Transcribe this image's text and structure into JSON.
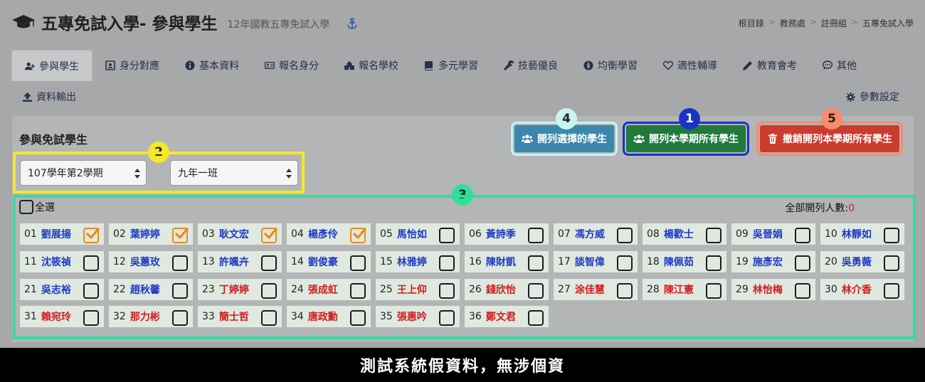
{
  "header": {
    "title": "五專免試入學- 參與學生",
    "subtitle": "12年國教五專免試入學",
    "breadcrumb": [
      "根目錄",
      "教務處",
      "註冊組",
      "五專免試入學"
    ]
  },
  "tabs": [
    {
      "label": "參與學生",
      "icon": "user-plus-icon",
      "active": true
    },
    {
      "label": "身分對應",
      "icon": "id-badge-icon"
    },
    {
      "label": "基本資料",
      "icon": "info-circle-icon"
    },
    {
      "label": "報名身分",
      "icon": "id-card-icon"
    },
    {
      "label": "報名學校",
      "icon": "school-icon"
    },
    {
      "label": "多元學習",
      "icon": "book-icon"
    },
    {
      "label": "技藝優良",
      "icon": "wrench-icon"
    },
    {
      "label": "均衡學習",
      "icon": "accessibility-icon"
    },
    {
      "label": "適性輔導",
      "icon": "heart-icon"
    },
    {
      "label": "教育會考",
      "icon": "pencil-icon"
    },
    {
      "label": "其他",
      "icon": "chat-icon"
    }
  ],
  "toolbar": {
    "export_label": "資料輸出",
    "params_label": "參數設定"
  },
  "panel": {
    "title": "參與免試學生",
    "buttons": {
      "list_selected": "開列選擇的學生",
      "list_all": "開列本學期所有學生",
      "cancel_all": "撤銷開列本學期所有學生"
    },
    "semester_select": "107學年第2學期",
    "class_select": "九年一班",
    "select_all_label": "全選",
    "total_label": "全部開列人數:",
    "total_count": "0"
  },
  "badges": [
    "1",
    "2",
    "3",
    "4",
    "5"
  ],
  "colors": {
    "boy_name": "#1f39c4",
    "girl_name": "#d01c1c",
    "checked_box": "#eb8a1a",
    "highlight_yellow": "#f4e82a",
    "highlight_green": "#2fe09a",
    "highlight_blue": "#1434c8",
    "highlight_cyan": "#c8f5ee",
    "highlight_orange": "#f58c6c"
  },
  "students": [
    {
      "num": "01",
      "name": "劉展揚",
      "gender": "boy",
      "checked": true
    },
    {
      "num": "02",
      "name": "葉婷婷",
      "gender": "boy",
      "checked": true
    },
    {
      "num": "03",
      "name": "耿文宏",
      "gender": "boy",
      "checked": true
    },
    {
      "num": "04",
      "name": "楊彥伶",
      "gender": "boy",
      "checked": true
    },
    {
      "num": "05",
      "name": "馬怡如",
      "gender": "boy",
      "checked": false
    },
    {
      "num": "06",
      "name": "黃詩季",
      "gender": "boy",
      "checked": false
    },
    {
      "num": "07",
      "name": "馮方威",
      "gender": "boy",
      "checked": false
    },
    {
      "num": "08",
      "name": "楊歡士",
      "gender": "boy",
      "checked": false
    },
    {
      "num": "09",
      "name": "吳晉娟",
      "gender": "boy",
      "checked": false
    },
    {
      "num": "10",
      "name": "林靜如",
      "gender": "boy",
      "checked": false
    },
    {
      "num": "11",
      "name": "沈筱禎",
      "gender": "boy",
      "checked": false
    },
    {
      "num": "12",
      "name": "吳蕙玫",
      "gender": "boy",
      "checked": false
    },
    {
      "num": "13",
      "name": "許颯卉",
      "gender": "boy",
      "checked": false
    },
    {
      "num": "14",
      "name": "劉俊豪",
      "gender": "boy",
      "checked": false
    },
    {
      "num": "15",
      "name": "林雅婷",
      "gender": "boy",
      "checked": false
    },
    {
      "num": "16",
      "name": "陳財凱",
      "gender": "boy",
      "checked": false
    },
    {
      "num": "17",
      "name": "談智偉",
      "gender": "boy",
      "checked": false
    },
    {
      "num": "18",
      "name": "陳佩茹",
      "gender": "boy",
      "checked": false
    },
    {
      "num": "19",
      "name": "施彥宏",
      "gender": "boy",
      "checked": false
    },
    {
      "num": "20",
      "name": "吳勇薇",
      "gender": "boy",
      "checked": false
    },
    {
      "num": "21",
      "name": "吳志裕",
      "gender": "boy",
      "checked": false
    },
    {
      "num": "22",
      "name": "趙秋馨",
      "gender": "boy",
      "checked": false
    },
    {
      "num": "23",
      "name": "丁婷婷",
      "gender": "girl",
      "checked": false
    },
    {
      "num": "24",
      "name": "張成虹",
      "gender": "girl",
      "checked": false
    },
    {
      "num": "25",
      "name": "王上仰",
      "gender": "girl",
      "checked": false
    },
    {
      "num": "26",
      "name": "錢欣怡",
      "gender": "girl",
      "checked": false
    },
    {
      "num": "27",
      "name": "涂佳慧",
      "gender": "girl",
      "checked": false
    },
    {
      "num": "28",
      "name": "陳江憲",
      "gender": "girl",
      "checked": false
    },
    {
      "num": "29",
      "name": "林怡梅",
      "gender": "girl",
      "checked": false
    },
    {
      "num": "30",
      "name": "林介香",
      "gender": "girl",
      "checked": false
    },
    {
      "num": "31",
      "name": "賴宛玲",
      "gender": "girl",
      "checked": false
    },
    {
      "num": "32",
      "name": "那力彬",
      "gender": "girl",
      "checked": false
    },
    {
      "num": "33",
      "name": "簡士哲",
      "gender": "girl",
      "checked": false
    },
    {
      "num": "34",
      "name": "唐政勳",
      "gender": "girl",
      "checked": false
    },
    {
      "num": "35",
      "name": "張惠吟",
      "gender": "girl",
      "checked": false
    },
    {
      "num": "36",
      "name": "鄭文君",
      "gender": "girl",
      "checked": false
    }
  ],
  "footer": {
    "notice": "測試系統假資料，無涉個資"
  }
}
